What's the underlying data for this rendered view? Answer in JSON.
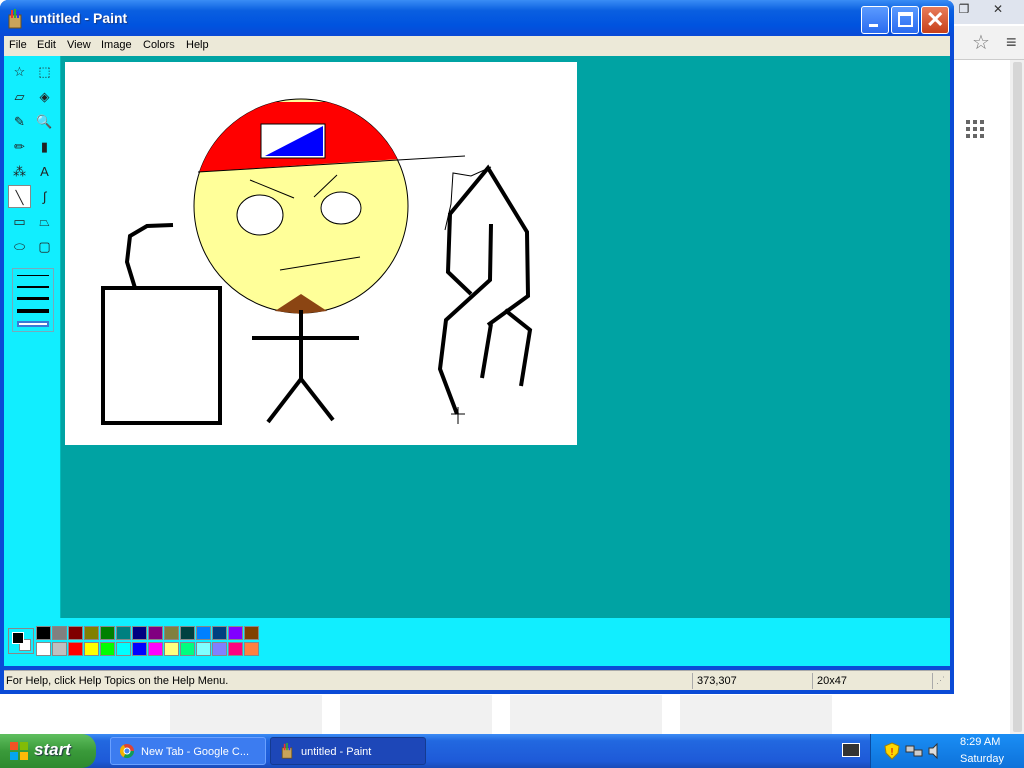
{
  "window": {
    "title": "untitled - Paint",
    "close_glyph": "✕"
  },
  "menu": [
    "File",
    "Edit",
    "View",
    "Image",
    "Colors",
    "Help"
  ],
  "tools": [
    {
      "name": "free-form-select-icon",
      "glyph": "☆"
    },
    {
      "name": "select-icon",
      "glyph": "⬚"
    },
    {
      "name": "eraser-icon",
      "glyph": "▱"
    },
    {
      "name": "fill-with-color-icon",
      "glyph": "◈"
    },
    {
      "name": "pick-color-icon",
      "glyph": "✎"
    },
    {
      "name": "magnifier-icon",
      "glyph": "🔍"
    },
    {
      "name": "pencil-icon",
      "glyph": "✏"
    },
    {
      "name": "brush-icon",
      "glyph": "▮"
    },
    {
      "name": "airbrush-icon",
      "glyph": "⁂"
    },
    {
      "name": "text-icon",
      "glyph": "A"
    },
    {
      "name": "line-icon",
      "glyph": "╲"
    },
    {
      "name": "curve-icon",
      "glyph": "∫"
    },
    {
      "name": "rectangle-icon",
      "glyph": "▭"
    },
    {
      "name": "polygon-icon",
      "glyph": "⏢"
    },
    {
      "name": "ellipse-icon",
      "glyph": "⬭"
    },
    {
      "name": "rounded-rectangle-icon",
      "glyph": "▢"
    }
  ],
  "selected_tool": "line-icon",
  "palette": {
    "top": [
      "#000000",
      "#808080",
      "#800000",
      "#808000",
      "#008000",
      "#008080",
      "#000080",
      "#800080",
      "#808040",
      "#004040",
      "#0080ff",
      "#004080",
      "#8000ff",
      "#804000"
    ],
    "bottom": [
      "#ffffff",
      "#c0c0c0",
      "#ff0000",
      "#ffff00",
      "#00ff00",
      "#00ffff",
      "#0000ff",
      "#ff00ff",
      "#ffff80",
      "#00ff80",
      "#80ffff",
      "#8080ff",
      "#ff0080",
      "#ff8040"
    ],
    "foreground": "#000000",
    "background": "#ffffff"
  },
  "status": {
    "help": "For Help, click Help Topics on the Help Menu.",
    "cursor_pos": "373,307",
    "selection_size": "20x47"
  },
  "taskbar": {
    "start": "start",
    "tasks": [
      {
        "label": "New Tab - Google C...",
        "icon": "chrome-icon"
      },
      {
        "label": "untitled - Paint",
        "icon": "paint-icon"
      }
    ],
    "time": "8:29 AM",
    "day": "Saturday"
  },
  "colors": {
    "workspace": "#00a3a3",
    "toolbox": "#11eeff",
    "titlebar": "#0053df"
  }
}
